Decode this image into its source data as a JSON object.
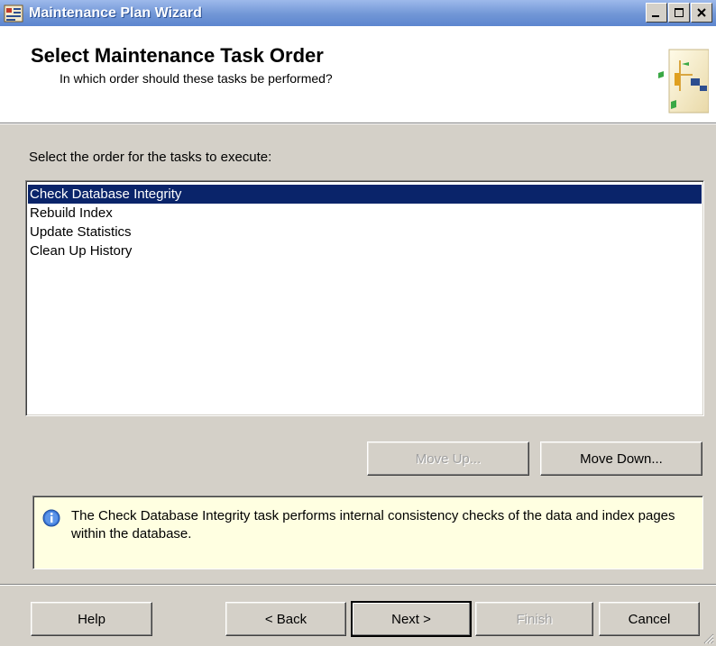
{
  "window": {
    "title": "Maintenance Plan Wizard",
    "controls": {
      "minimize": "_",
      "maximize": "□",
      "close": "×"
    }
  },
  "header": {
    "title": "Select Maintenance Task Order",
    "subtitle": "In which order should these tasks be performed?"
  },
  "main": {
    "instructions": "Select the order for the tasks to execute:",
    "tasks": [
      {
        "label": "Check Database Integrity",
        "selected": true
      },
      {
        "label": "Rebuild Index",
        "selected": false
      },
      {
        "label": "Update Statistics",
        "selected": false
      },
      {
        "label": "Clean Up History",
        "selected": false
      }
    ],
    "move_up_label": "Move Up...",
    "move_down_label": "Move Down...",
    "info_text": "The Check Database Integrity task performs internal consistency checks of the data and index pages within the database."
  },
  "footer": {
    "help_label": "Help",
    "back_label": "< Back",
    "next_label": "Next >",
    "finish_label": "Finish",
    "cancel_label": "Cancel"
  },
  "colors": {
    "selection": "#0a246a",
    "info_background": "#ffffe1",
    "dialog_background": "#d4d0c8"
  }
}
